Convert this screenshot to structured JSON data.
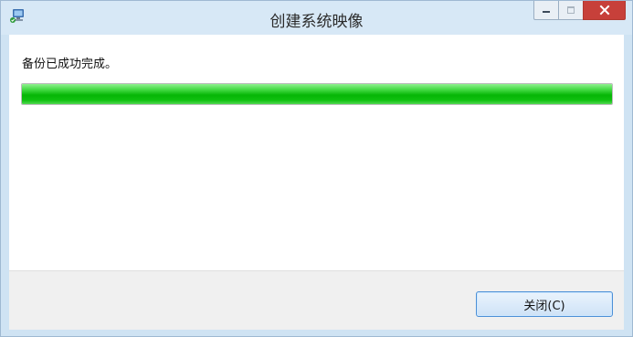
{
  "window": {
    "title": "创建系统映像",
    "icon": "backup-app-icon"
  },
  "caption_buttons": {
    "minimize_icon": "minimize-icon",
    "maximize_icon": "maximize-icon",
    "close_icon": "close-icon"
  },
  "content": {
    "message": "备份已成功完成。",
    "progress_percent": 100
  },
  "footer": {
    "close_label": "关闭(C)"
  },
  "colors": {
    "progress_fill": "#06b606",
    "close_button_accent": "#c7403a",
    "primary_button_border": "#4c8fd6"
  }
}
